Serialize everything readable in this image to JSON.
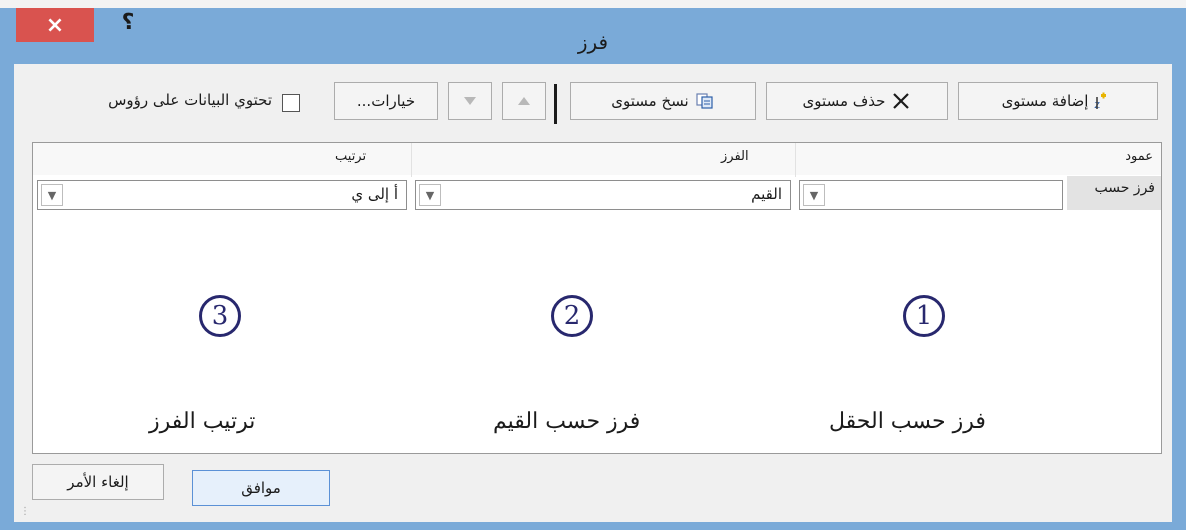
{
  "dialog": {
    "title": "فرز",
    "close_glyph": "×",
    "help_glyph": "؟"
  },
  "toolbar": {
    "add_level": "إضافة مستوى",
    "delete_level": "حذف مستوى",
    "copy_level": "نسخ مستوى",
    "options": "خيارات...",
    "header_checkbox_label": "تحتوي البيانات على رؤوس"
  },
  "grid": {
    "columns": {
      "column": "عمود",
      "sort_on": "الفرز",
      "order": "ترتيب"
    },
    "rows": [
      {
        "label": "فرز حسب",
        "column_value": "",
        "sort_on_value": "القيم",
        "order_value": "أ إلى ي"
      }
    ]
  },
  "annotations": [
    {
      "number": "1",
      "caption": "فرز حسب الحقل"
    },
    {
      "number": "2",
      "caption": "فرز حسب القيم"
    },
    {
      "number": "3",
      "caption": "ترتيب الفرز"
    }
  ],
  "footer": {
    "ok": "موافق",
    "cancel": "إلغاء الأمر"
  },
  "icons": {
    "add_level": "add-sort-level-icon",
    "delete_level": "delete-x-icon",
    "copy_level": "copy-icon",
    "move_up": "triangle-up-icon",
    "move_down": "triangle-down-icon",
    "dropdown": "chevron-down-icon"
  },
  "colors": {
    "title_bar": "#7aaad8",
    "close_button": "#d9534f",
    "annotation": "#28286e"
  }
}
